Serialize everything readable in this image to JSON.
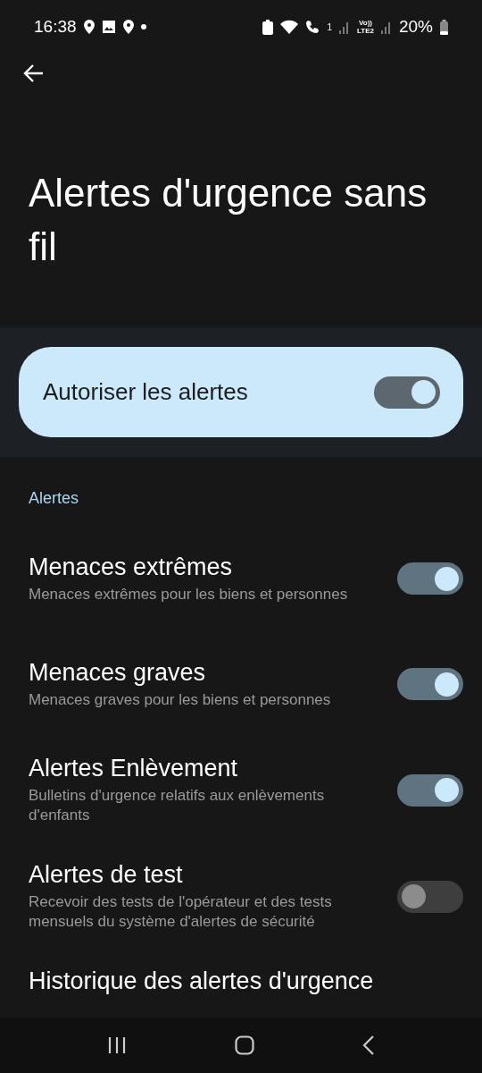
{
  "status_bar": {
    "time": "16:38",
    "sim_index": "1",
    "volte": [
      "Vo))",
      "LTE2"
    ],
    "battery": "20%"
  },
  "title": "Alertes d'urgence sans fil",
  "master": {
    "label": "Autoriser les alertes",
    "on": true
  },
  "section": "Alertes",
  "items": [
    {
      "kind": "toggle",
      "title": "Menaces extrêmes",
      "subtitle": "Menaces extrêmes pour les biens et personnes",
      "on": true
    },
    {
      "kind": "toggle",
      "title": "Menaces graves",
      "subtitle": "Menaces graves pour les biens et personnes",
      "on": true
    },
    {
      "kind": "toggle",
      "title": "Alertes Enlèvement",
      "subtitle": "Bulletins d'urgence relatifs aux enlèvements d'enfants",
      "on": true
    },
    {
      "kind": "toggle",
      "title": "Alertes de test",
      "subtitle": "Recevoir des tests de l'opérateur et des tests mensuels du système d'alertes de sécurité",
      "on": false
    },
    {
      "kind": "link",
      "title": "Historique des alertes d'urgence"
    }
  ]
}
